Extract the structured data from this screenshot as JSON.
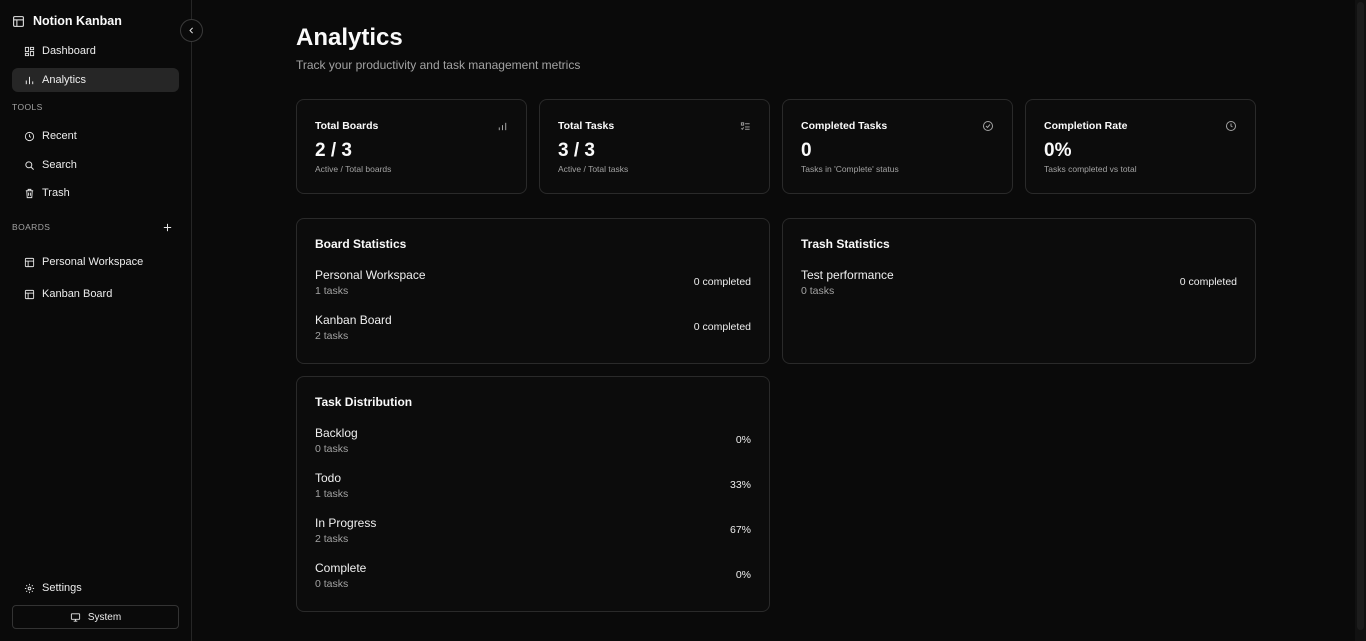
{
  "sidebar": {
    "brand": "Notion Kanban",
    "nav": [
      {
        "label": "Dashboard",
        "icon": "dashboard-icon"
      },
      {
        "label": "Analytics",
        "icon": "bar-chart-icon",
        "active": true
      }
    ],
    "tools_label": "TOOLS",
    "tools": [
      {
        "label": "Recent",
        "icon": "clock-icon"
      },
      {
        "label": "Search",
        "icon": "search-icon"
      },
      {
        "label": "Trash",
        "icon": "trash-icon"
      }
    ],
    "boards_label": "BOARDS",
    "boards": [
      {
        "label": "Personal Workspace",
        "icon": "board-icon"
      },
      {
        "label": "Kanban Board",
        "icon": "board-icon"
      }
    ],
    "settings_label": "Settings",
    "theme_label": "System"
  },
  "header": {
    "title": "Analytics",
    "subtitle": "Track your productivity and task management metrics"
  },
  "stats": [
    {
      "title": "Total Boards",
      "value": "2 / 3",
      "caption": "Active / Total boards",
      "icon": "bar-chart-icon"
    },
    {
      "title": "Total Tasks",
      "value": "3 / 3",
      "caption": "Active / Total tasks",
      "icon": "list-checks-icon"
    },
    {
      "title": "Completed Tasks",
      "value": "0",
      "caption": "Tasks in 'Complete' status",
      "icon": "check-circle-icon"
    },
    {
      "title": "Completion Rate",
      "value": "0%",
      "caption": "Tasks completed vs total",
      "icon": "clock-icon"
    }
  ],
  "board_statistics": {
    "title": "Board Statistics",
    "rows": [
      {
        "name": "Personal Workspace",
        "sub": "1 tasks",
        "value": "0 completed"
      },
      {
        "name": "Kanban Board",
        "sub": "2 tasks",
        "value": "0 completed"
      }
    ]
  },
  "trash_statistics": {
    "title": "Trash Statistics",
    "rows": [
      {
        "name": "Test performance",
        "sub": "0 tasks",
        "value": "0 completed"
      }
    ]
  },
  "task_distribution": {
    "title": "Task Distribution",
    "rows": [
      {
        "name": "Backlog",
        "sub": "0 tasks",
        "value": "0%"
      },
      {
        "name": "Todo",
        "sub": "1 tasks",
        "value": "33%"
      },
      {
        "name": "In Progress",
        "sub": "2 tasks",
        "value": "67%"
      },
      {
        "name": "Complete",
        "sub": "0 tasks",
        "value": "0%"
      }
    ]
  },
  "colors": {
    "background": "#0a0a0a",
    "border": "#2a2a2a",
    "muted_text": "#a3a3a3",
    "active_nav": "#262626"
  }
}
